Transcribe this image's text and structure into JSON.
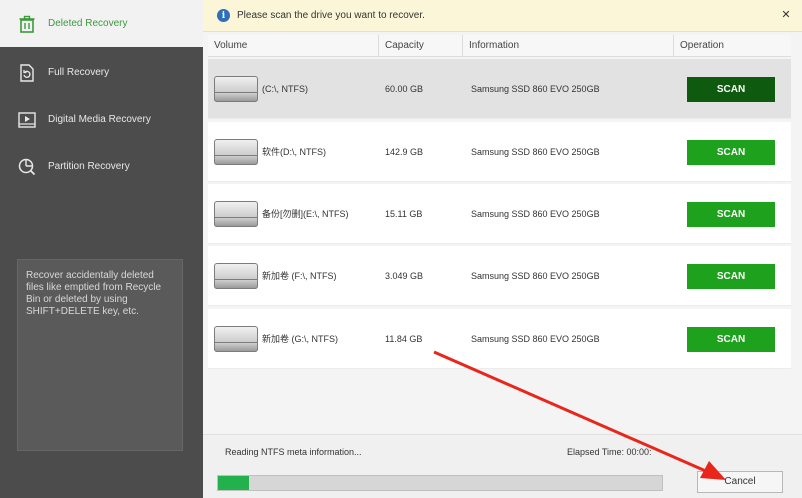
{
  "sidebar": {
    "items": [
      {
        "label": "Deleted Recovery",
        "icon": "trash-icon",
        "active": true
      },
      {
        "label": "Full Recovery",
        "icon": "document-refresh-icon"
      },
      {
        "label": "Digital Media Recovery",
        "icon": "media-play-icon"
      },
      {
        "label": "Partition Recovery",
        "icon": "partition-search-icon"
      }
    ],
    "description": "Recover accidentally deleted files like emptied from Recycle Bin or deleted by using SHIFT+DELETE key, etc."
  },
  "infobar": {
    "icon": "info-icon",
    "text": "Please scan the drive you want to recover.",
    "close": "✕"
  },
  "table": {
    "columns": [
      "Volume",
      "Capacity",
      "Information",
      "Operation"
    ],
    "rows": [
      {
        "volume": "(C:\\, NTFS)",
        "capacity": "60.00 GB",
        "info": "Samsung SSD 860 EVO 250GB",
        "action": "SCAN",
        "selected": true
      },
      {
        "volume": "软件(D:\\, NTFS)",
        "capacity": "142.9 GB",
        "info": "Samsung SSD 860 EVO 250GB",
        "action": "SCAN"
      },
      {
        "volume": "备份[勿删](E:\\, NTFS)",
        "capacity": "15.11 GB",
        "info": "Samsung SSD 860 EVO 250GB",
        "action": "SCAN"
      },
      {
        "volume": "新加卷 (F:\\, NTFS)",
        "capacity": "3.049 GB",
        "info": "Samsung SSD 860 EVO 250GB",
        "action": "SCAN"
      },
      {
        "volume": "新加卷 (G:\\, NTFS)",
        "capacity": "11.84 GB",
        "info": "Samsung SSD 860 EVO 250GB",
        "action": "SCAN"
      }
    ]
  },
  "status": {
    "reading": "Reading NTFS meta information...",
    "elapsed": "Elapsed Time: 00:00:",
    "progress": 0.07,
    "cancel": "Cancel"
  },
  "colors": {
    "scan_green": "#1ea21e",
    "scan_selected": "#0e5a0e",
    "sidebar": "#4c4c4c",
    "annotation_arrow": "#e8261c"
  }
}
